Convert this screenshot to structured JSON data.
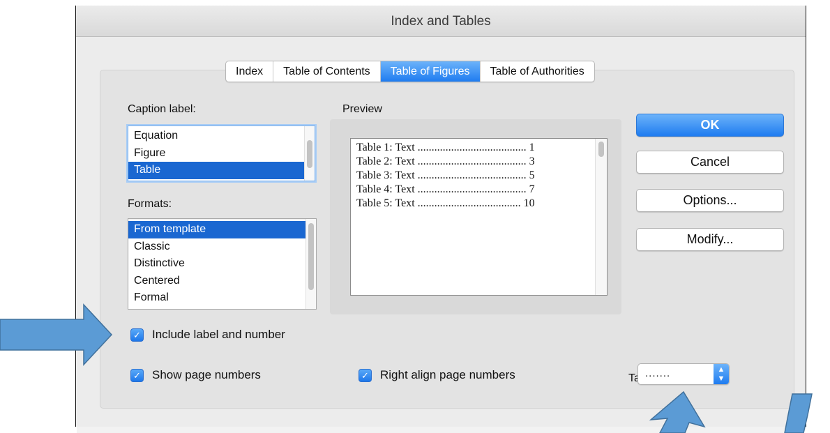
{
  "window": {
    "title": "Index and Tables"
  },
  "tabs": [
    {
      "label": "Index",
      "active": false
    },
    {
      "label": "Table of Contents",
      "active": false
    },
    {
      "label": "Table of Figures",
      "active": true
    },
    {
      "label": "Table of Authorities",
      "active": false
    }
  ],
  "caption_label": {
    "label": "Caption label:",
    "items": [
      "Equation",
      "Figure",
      "Table"
    ],
    "selected": "Table"
  },
  "formats": {
    "label": "Formats:",
    "items": [
      "From template",
      "Classic",
      "Distinctive",
      "Centered",
      "Formal"
    ],
    "selected": "From template"
  },
  "preview": {
    "label": "Preview",
    "lines": [
      "Table 1: Text ....................................... 1",
      "Table 2: Text ....................................... 3",
      "Table 3: Text ....................................... 5",
      "Table 4: Text ....................................... 7",
      "Table 5: Text ..................................... 10"
    ]
  },
  "buttons": {
    "ok": "OK",
    "cancel": "Cancel",
    "options": "Options...",
    "modify": "Modify..."
  },
  "checkboxes": {
    "include_label": {
      "label": "Include label and number",
      "checked": true
    },
    "show_page_numbers": {
      "label": "Show page numbers",
      "checked": true
    },
    "right_align": {
      "label": "Right align page numbers",
      "checked": true
    }
  },
  "tab_leader": {
    "label": "Tab leader:",
    "value": "......."
  },
  "colors": {
    "accent": "#1f7cf0",
    "selection": "#1a67d1",
    "annotation_arrow": "#5b9bd5"
  },
  "icons": {
    "checkmark": "checkmark-icon",
    "stepper": "up-down-stepper-icon"
  }
}
